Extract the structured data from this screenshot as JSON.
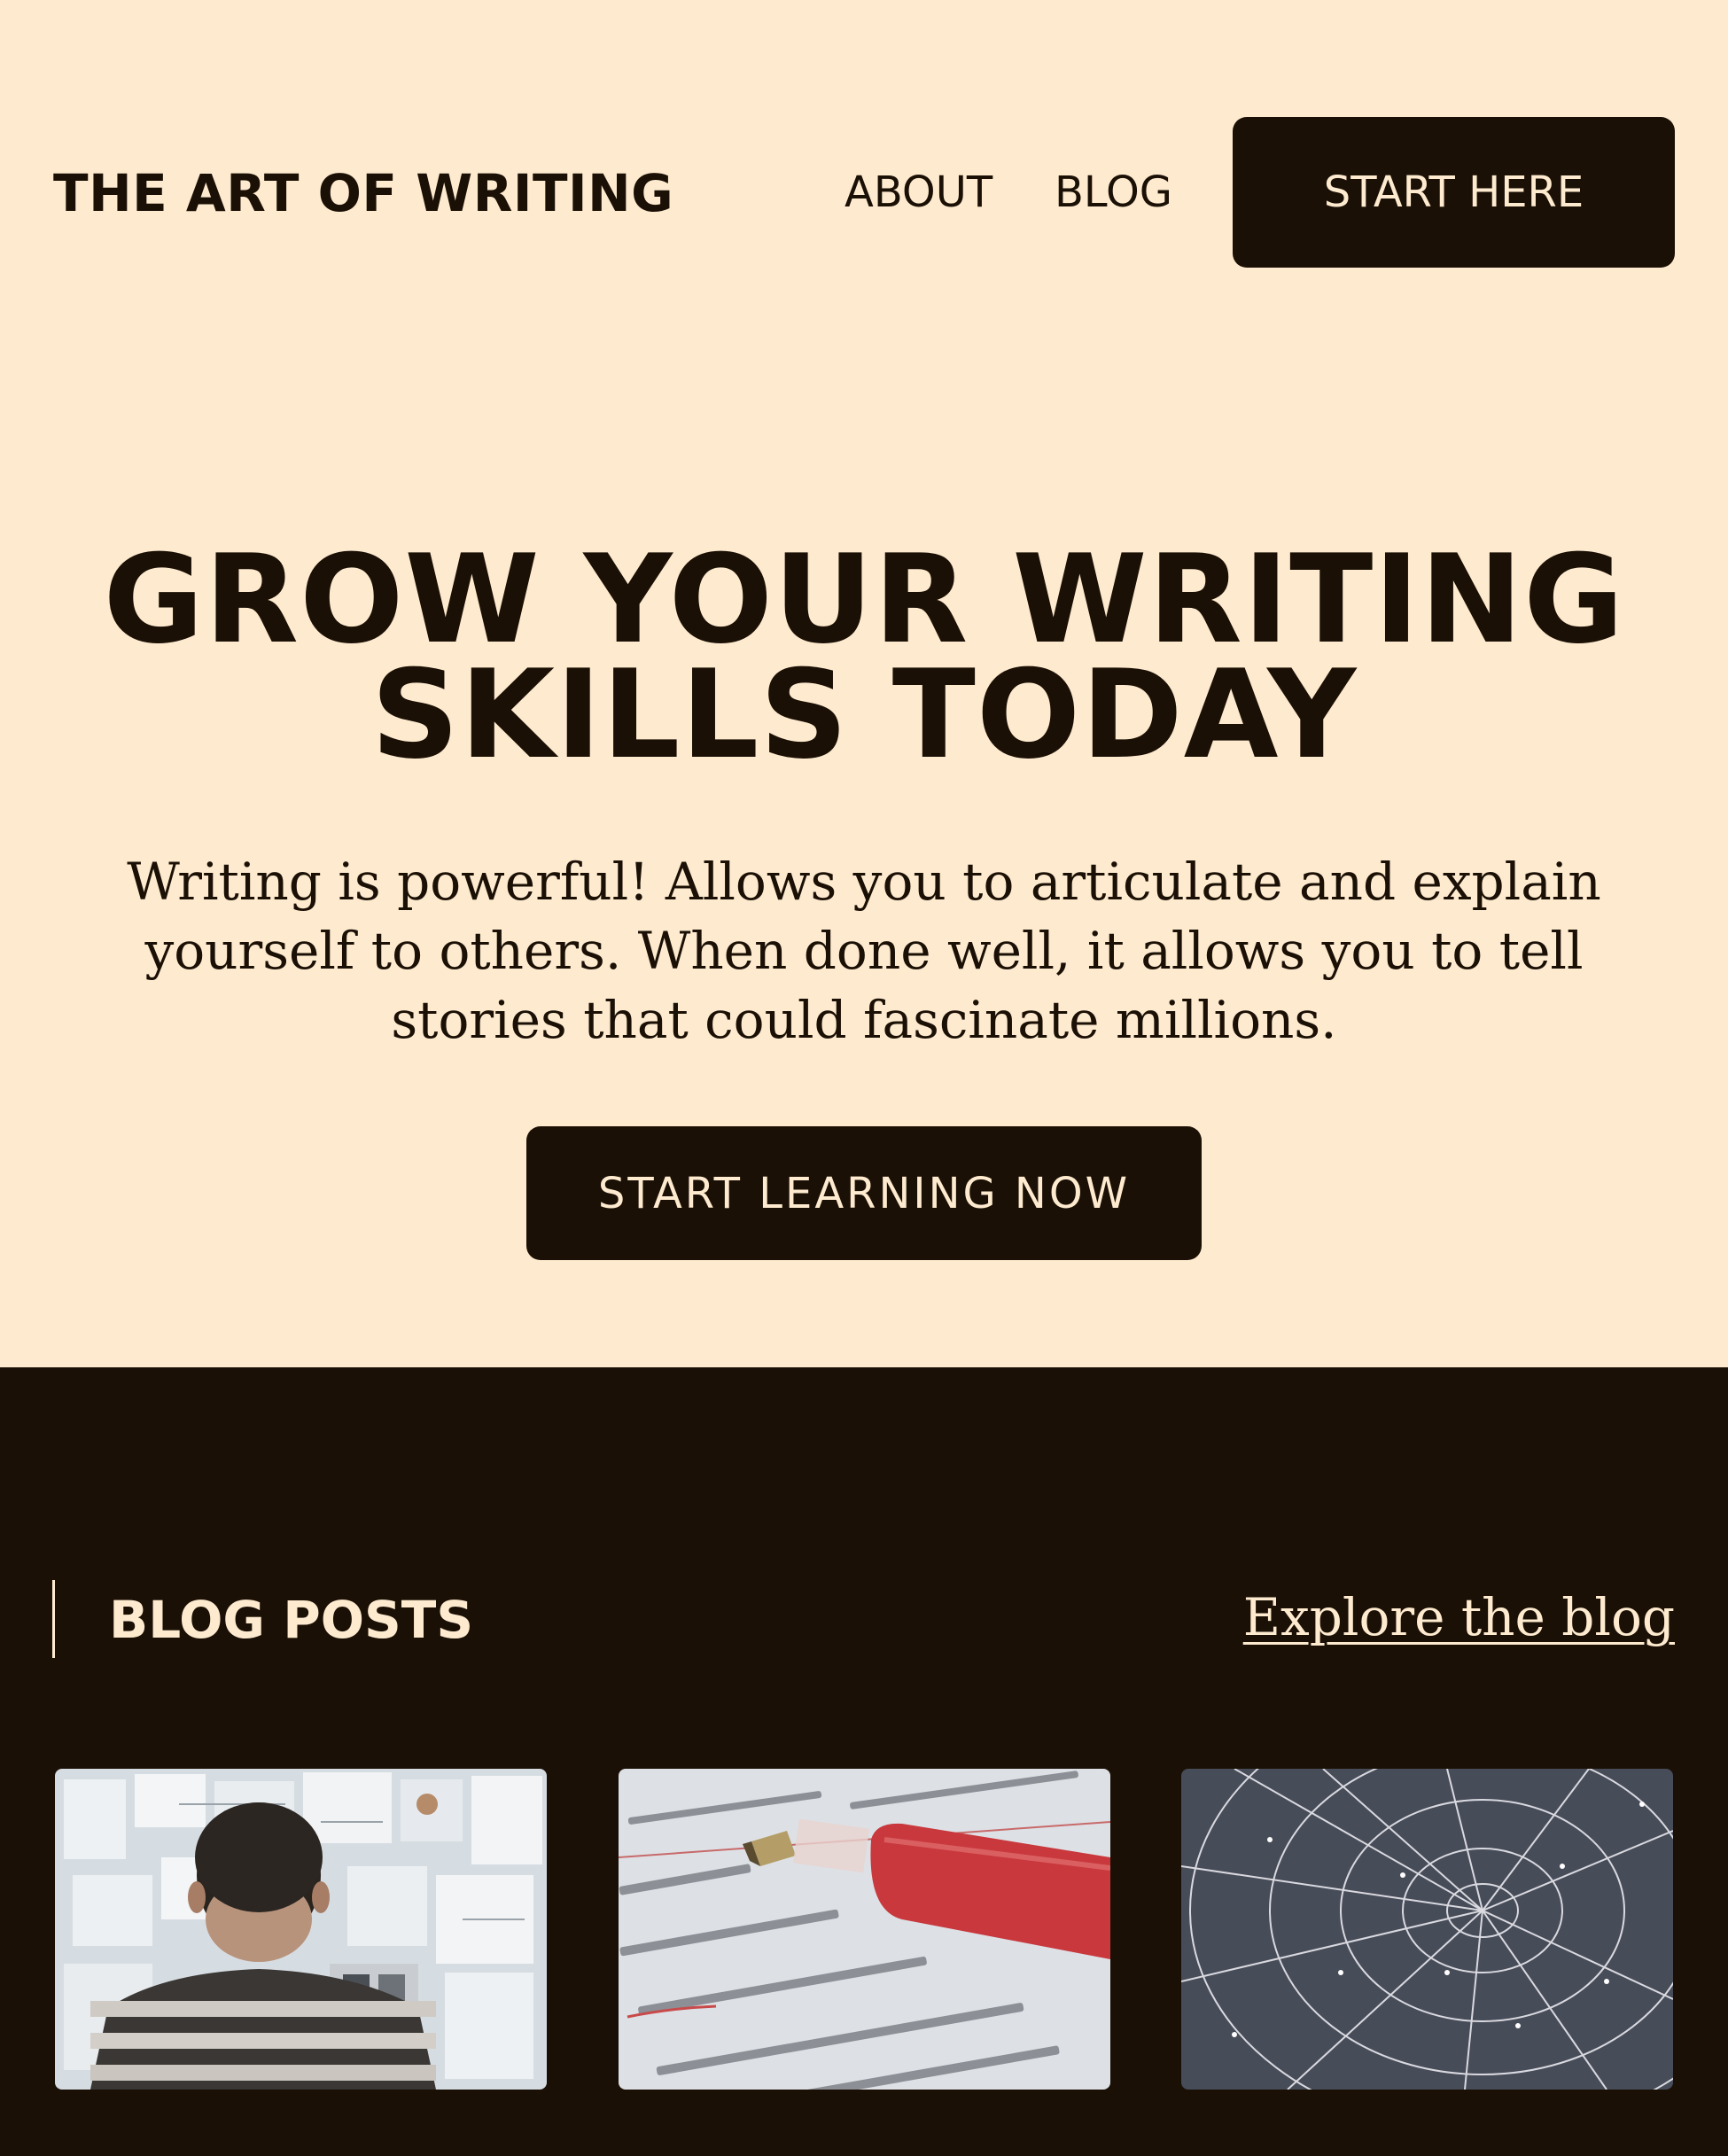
{
  "header": {
    "logo": "THE ART OF WRITING",
    "nav": [
      {
        "label": "ABOUT"
      },
      {
        "label": "BLOG"
      }
    ],
    "cta_label": "START HERE"
  },
  "hero": {
    "title_line1": "GROW YOUR WRITING",
    "title_line2": "SKILLS TODAY",
    "description": "Writing is powerful! Allows you to articulate and explain yourself to others. When done well, it allows you to tell stories that could fascinate millions.",
    "cta_label": "START LEARNING NOW"
  },
  "blog": {
    "heading": "BLOG POSTS",
    "explore_link": "Explore the blog",
    "posts": [
      {
        "image": "man-facing-wall-of-notes-photo"
      },
      {
        "image": "red-pen-on-printed-text-photo"
      },
      {
        "image": "spider-web-photo"
      }
    ]
  },
  "colors": {
    "background": "#feebcf",
    "dark": "#1b1006",
    "light_text": "#feebcf"
  }
}
